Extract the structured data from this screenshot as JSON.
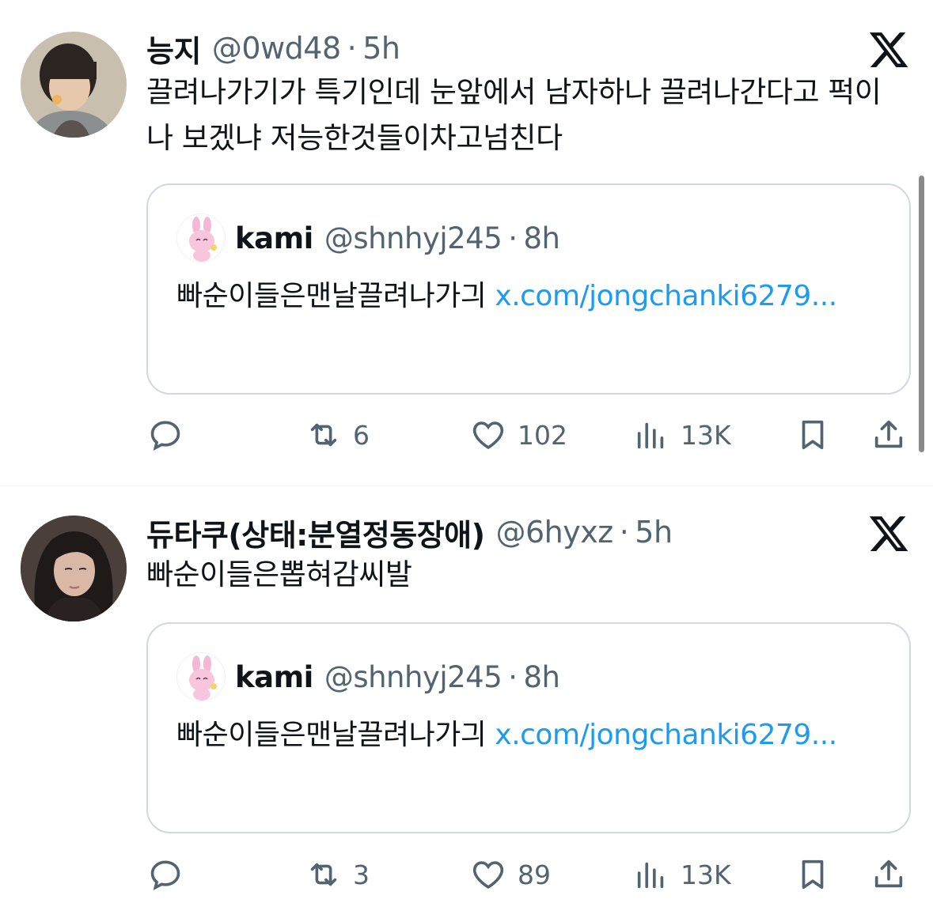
{
  "tweets": [
    {
      "author_name": "능지",
      "handle": "@0wd48",
      "dot": "·",
      "time": "5h",
      "text": "끌려나가기가 특기인데 눈앞에서 남자하나 끌려나간다고 퍽이나 보겠냐 저능한것들이차고넘친다",
      "quote": {
        "author_name": "kami",
        "handle": "@shnhyj245",
        "dot": "·",
        "time": "8h",
        "text": "빠순이들은맨날끌려나가긔 ",
        "link": "x.com/jongchanki6279..."
      },
      "actions": {
        "replies": "",
        "retweets": "6",
        "likes": "102",
        "views": "13K"
      }
    },
    {
      "author_name": "듀타쿠(상태:분열정동장애)",
      "handle": "@6hyxz",
      "dot": "·",
      "time": "5h",
      "text": "빠순이들은뽑혀감씨발",
      "quote": {
        "author_name": "kami",
        "handle": "@shnhyj245",
        "dot": "·",
        "time": "8h",
        "text": "빠순이들은맨날끌려나가긔 ",
        "link": "x.com/jongchanki6279..."
      },
      "actions": {
        "replies": "",
        "retweets": "3",
        "likes": "89",
        "views": "13K"
      }
    }
  ],
  "icons": {
    "platform": "x-logo-icon",
    "reply": "speech-bubble-icon",
    "retweet": "retweet-arrows-icon",
    "like": "heart-icon",
    "views": "bar-chart-icon",
    "bookmark": "bookmark-icon",
    "share": "share-upload-icon"
  },
  "colors": {
    "text": "#0f1419",
    "muted": "#536471",
    "link": "#1d9bf0",
    "border": "#cfd9de"
  }
}
